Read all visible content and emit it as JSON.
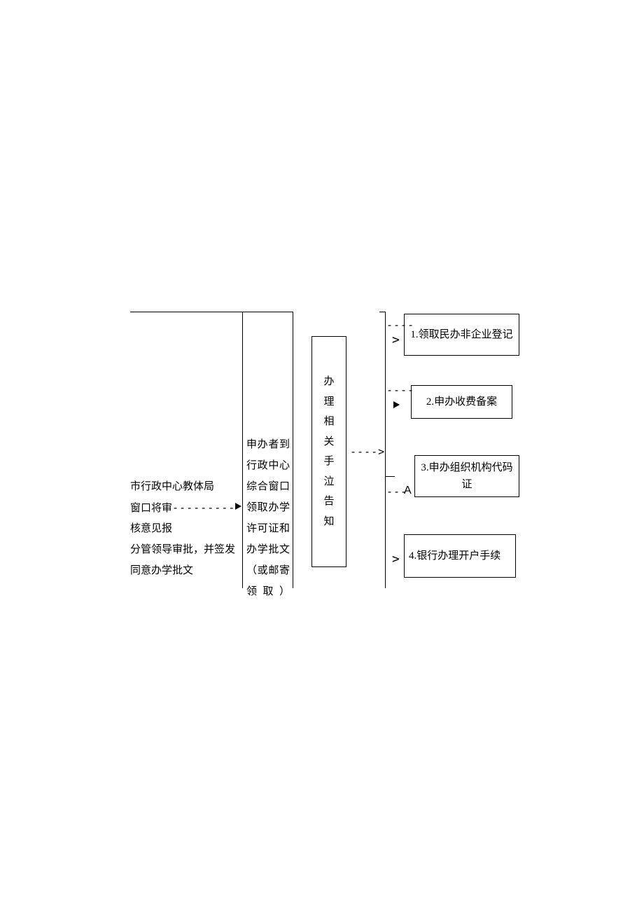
{
  "left_block": {
    "line1": "市行政中心教体局",
    "line2": "窗口将审",
    "line3": "核意见报",
    "line4": "分管领导审批，并签发",
    "line5": "同意办学批文"
  },
  "mid_block": {
    "text": "申办者到行政中心综合窗口领取办学许可证和办学批文（或邮寄领取）"
  },
  "center_block": {
    "text": "办理相关手泣告知"
  },
  "right_items": {
    "item1": "1.领取民办非企业登记",
    "item2": "2.申办收费备案",
    "item3": "3.申办组织机构代码证",
    "item4": "4.银行办理开户手续"
  },
  "arrows": {
    "d1": "---------",
    "d_short": "----",
    "d_gt": "---->",
    "d3": "---",
    "gt": ">",
    "A": "A"
  }
}
